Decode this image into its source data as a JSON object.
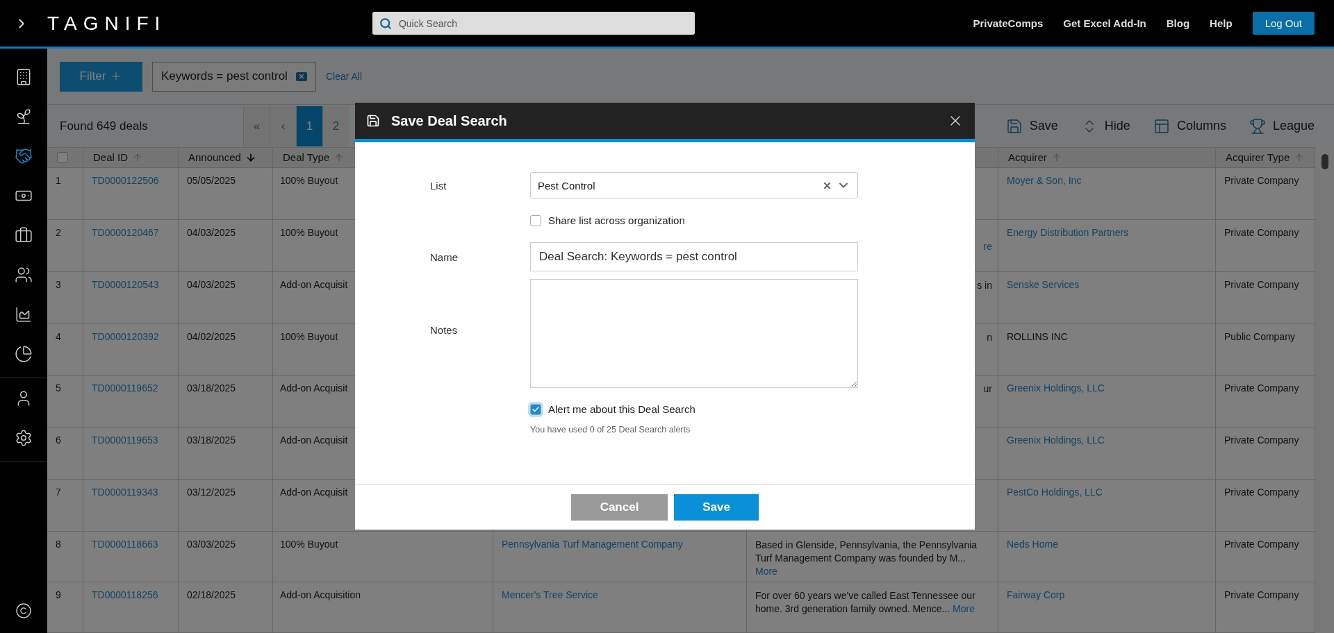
{
  "topbar": {
    "logo": "TAGNIFI",
    "search": {
      "placeholder": "Quick Search"
    },
    "links": [
      "PrivateComps",
      "Get Excel Add-In",
      "Blog",
      "Help"
    ],
    "logout": "Log Out"
  },
  "sidebar": {
    "nav": [
      {
        "selected": false
      },
      {
        "selected": false
      },
      {
        "selected": true
      },
      {
        "selected": false
      },
      {
        "selected": false
      },
      {
        "selected": false
      },
      {
        "selected": false
      },
      {
        "selected": false
      }
    ],
    "account": [
      {
        "selected": false
      },
      {
        "selected": false
      }
    ]
  },
  "filter_bar": {
    "button": "Filter",
    "chips": [
      "Keywords = pest control"
    ],
    "clear": "Clear All"
  },
  "toolbar": {
    "count": "Found 649 deals",
    "pages": [
      {
        "label": "«",
        "selected": false
      },
      {
        "label": "‹",
        "selected": false
      },
      {
        "label": "1",
        "selected": true
      },
      {
        "label": "2",
        "selected": false
      }
    ],
    "actions": [
      "Save",
      "Hide",
      "Columns",
      "League"
    ]
  },
  "table": {
    "select_all": {
      "checked": false
    },
    "columns": [
      {
        "label": "Deal ID",
        "descending": false,
        "active": false
      },
      {
        "label": "Announced",
        "descending": true,
        "active": true
      },
      {
        "label": "Deal Type",
        "descending": false,
        "active": false
      },
      {
        "label": "Acquirer",
        "descending": false,
        "active": false
      },
      {
        "label": "Acquirer Type",
        "descending": false,
        "active": false
      }
    ],
    "rows": [
      {
        "number": "1",
        "deal_id": "TD0000122506",
        "announced": "05/05/2025",
        "deal_type": "100% Buyout",
        "acquirer": "Moyer & Son, Inc",
        "linked": true,
        "acquirer_type": "Private Company"
      },
      {
        "number": "2",
        "deal_id": "TD0000120467",
        "announced": "04/03/2025",
        "deal_type": "100% Buyout",
        "more_tail": "re",
        "acquirer": "Energy Distribution Partners",
        "linked": true,
        "acquirer_type": "Private Company"
      },
      {
        "number": "3",
        "deal_id": "TD0000120543",
        "announced": "04/03/2025",
        "deal_type": "Add-on Acquisit",
        "description_tail": "s in",
        "acquirer": "Senske Services",
        "linked": true,
        "acquirer_type": "Private Company"
      },
      {
        "number": "4",
        "deal_id": "TD0000120392",
        "announced": "04/02/2025",
        "deal_type": "100% Buyout",
        "description_tail": "n",
        "acquirer": "ROLLINS INC",
        "linked": false,
        "acquirer_type": "Public Company"
      },
      {
        "number": "5",
        "deal_id": "TD0000119652",
        "announced": "03/18/2025",
        "deal_type": "Add-on Acquisit",
        "description_tail": "ur",
        "acquirer": "Greenix Holdings, LLC",
        "linked": true,
        "acquirer_type": "Private Company"
      },
      {
        "number": "6",
        "deal_id": "TD0000119653",
        "announced": "03/18/2025",
        "deal_type": "Add-on Acquisit",
        "acquirer": "Greenix Holdings, LLC",
        "linked": true,
        "acquirer_type": "Private Company"
      },
      {
        "number": "7",
        "deal_id": "TD0000119343",
        "announced": "03/12/2025",
        "deal_type": "Add-on Acquisit",
        "acquirer": "PestCo Holdings, LLC",
        "linked": true,
        "acquirer_type": "Private Company"
      },
      {
        "number": "8",
        "deal_id": "TD0000118663",
        "announced": "03/03/2025",
        "deal_type": "100% Buyout",
        "target": "Pennsylvania Turf Management Company",
        "description": "Based in Glenside, Pennsylvania, the Pennsylvania Turf Management Company was founded by M...",
        "more": "More",
        "acquirer": "Neds Home",
        "linked": true,
        "acquirer_type": "Private Company"
      },
      {
        "number": "9",
        "deal_id": "TD0000118256",
        "announced": "02/18/2025",
        "deal_type": "Add-on Acquisition",
        "target": "Mencer's Tree Service",
        "description": "For over 60 years we've called East Tennessee our home. 3rd generation family owned. Mence...",
        "more": "More",
        "acquirer": "Fairway Corp",
        "linked": true,
        "acquirer_type": "Private Company"
      }
    ]
  },
  "dialog": {
    "title": "Save Deal Search",
    "list": {
      "label": "List",
      "value": "Pest Control"
    },
    "share": {
      "label": "Share list across organization",
      "checked": false
    },
    "name": {
      "label": "Name",
      "value": "Deal Search: Keywords = pest control"
    },
    "notes": {
      "label": "Notes"
    },
    "alert": {
      "label": "Alert me about this Deal Search",
      "checked": true
    },
    "hint": "You have used 0 of 25 Deal Search alerts",
    "buttons": {
      "cancel": "Cancel",
      "save": "Save"
    }
  }
}
